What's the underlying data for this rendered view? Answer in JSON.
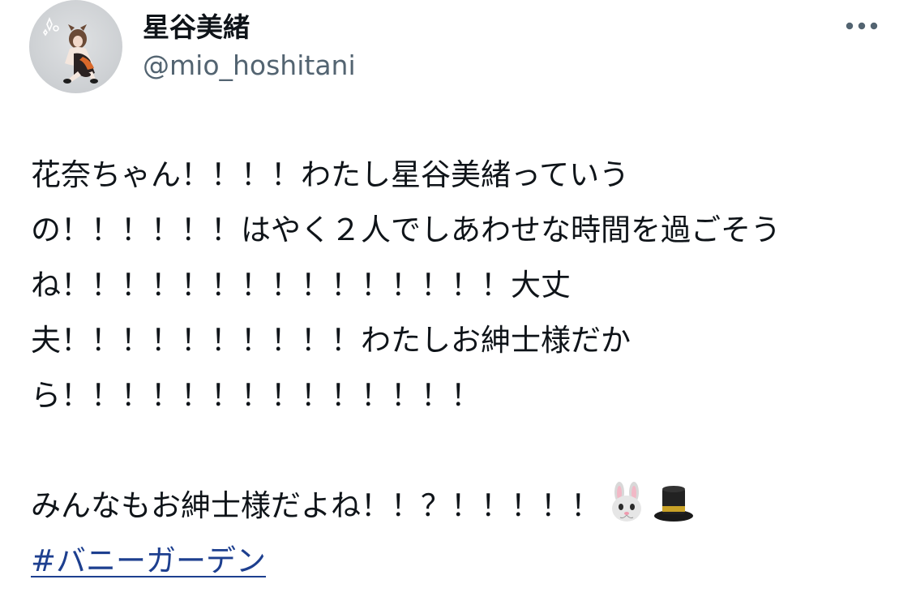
{
  "user": {
    "display_name": "星谷美緒",
    "handle": "@mio_hoshitani",
    "avatar_icon": "profile-photo-avatar"
  },
  "header": {
    "more_icon": "more-options-icon"
  },
  "tweet": {
    "lines": [
      "花奈ちゃん！！！！わたし星谷美緒っていう",
      "の！！！！！！はやく２人でしあわせな時間を過ごそう",
      "ね！！！！！！！！！！！！！！！大丈",
      "夫！！！！！！！！！！わたしお紳士様だか",
      "ら！！！！！！！！！！！！！！"
    ],
    "last_line_text": "みんなもお紳士様だよね！！？！！！！！",
    "emoji": [
      "rabbit-face-icon",
      "top-hat-icon"
    ],
    "hashtag": "#バニーガーデン"
  },
  "colors": {
    "text": "#0f1419",
    "handle": "#536471",
    "hashtag": "#1d3f8f"
  }
}
